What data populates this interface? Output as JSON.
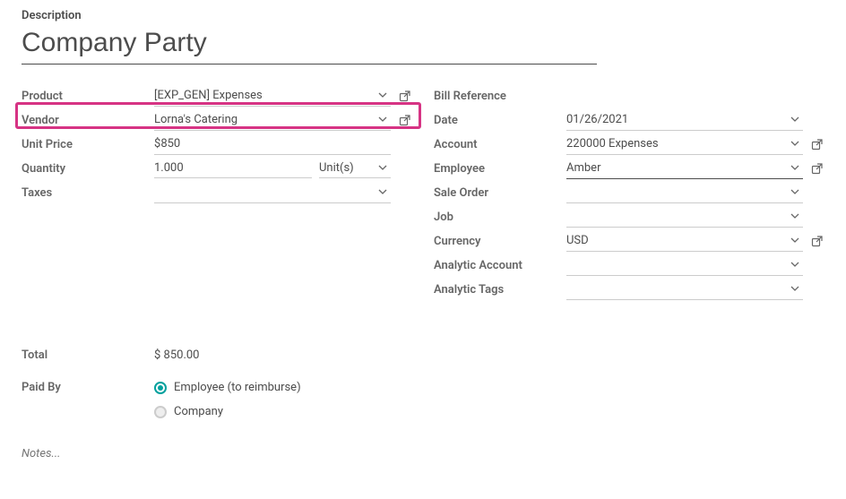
{
  "description": {
    "label": "Description",
    "value": "Company Party"
  },
  "left": {
    "product": {
      "label": "Product",
      "value": "[EXP_GEN] Expenses"
    },
    "vendor": {
      "label": "Vendor",
      "value": "Lorna's Catering"
    },
    "unit_price": {
      "label": "Unit Price",
      "value": "850",
      "currency": "$"
    },
    "quantity": {
      "label": "Quantity",
      "value": "1.000",
      "uom": "Unit(s)"
    },
    "taxes": {
      "label": "Taxes",
      "value": ""
    }
  },
  "right": {
    "bill_ref": {
      "label": "Bill Reference",
      "value": ""
    },
    "date": {
      "label": "Date",
      "value": "01/26/2021"
    },
    "account": {
      "label": "Account",
      "value": "220000 Expenses"
    },
    "employee": {
      "label": "Employee",
      "value": "Amber"
    },
    "sale_order": {
      "label": "Sale Order",
      "value": ""
    },
    "job": {
      "label": "Job",
      "value": ""
    },
    "currency": {
      "label": "Currency",
      "value": "USD"
    },
    "analytic_account": {
      "label": "Analytic Account",
      "value": ""
    },
    "analytic_tags": {
      "label": "Analytic Tags",
      "value": ""
    }
  },
  "total": {
    "label": "Total",
    "value": "$ 850.00"
  },
  "paid_by": {
    "label": "Paid By",
    "options": {
      "employee": "Employee (to reimburse)",
      "company": "Company"
    },
    "selected": "employee"
  },
  "notes": {
    "placeholder": "Notes..."
  },
  "colors": {
    "highlight": "#d63384",
    "teal": "#00a09d"
  }
}
